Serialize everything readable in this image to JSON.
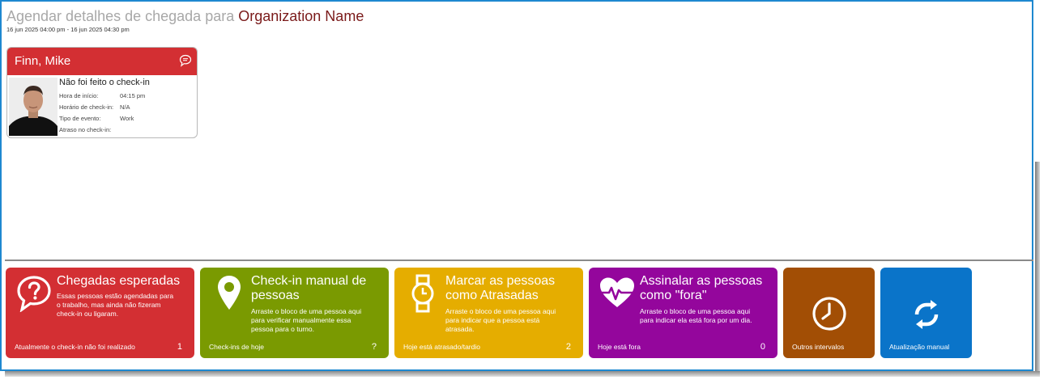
{
  "header": {
    "title_prefix": "Agendar detalhes de chegada para",
    "org_name": "Organization Name",
    "date_range": "16 jun 2025 04:00 pm - 16 jun 2025 04:30 pm"
  },
  "person_card": {
    "name": "Finn, Mike",
    "status": "Não foi feito o check-in",
    "fields": [
      {
        "label": "Hora de início:",
        "value": "04:15 pm"
      },
      {
        "label": "Horário de check-in:",
        "value": "N/A"
      },
      {
        "label": "Tipo de evento:",
        "value": "Work"
      },
      {
        "label": "Atraso no check-in:",
        "value": ""
      }
    ],
    "header_color": "#d32f33",
    "icon": "chat-bubble-icon"
  },
  "tiles": [
    {
      "title_line1": "Chegadas esperadas",
      "title_line2": "",
      "desc": [
        "Essas pessoas estão agendadas para",
        "o trabalho, mas ainda não fizeram",
        "check-in ou ligaram."
      ],
      "footer": "Atualmente o check-in não foi realizado",
      "count": "1",
      "color": "#d32f33",
      "icon": "question-bubble-icon"
    },
    {
      "title_line1": "Check-in manual de",
      "title_line2": "pessoas",
      "desc": [
        "Arraste o bloco de uma pessoa aqui",
        "para verificar manualmente essa",
        "pessoa para o turno."
      ],
      "footer": "Check-ins de hoje",
      "count": "?",
      "color": "#7a9a01",
      "icon": "map-pin-icon"
    },
    {
      "title_line1": "Marcar as pessoas",
      "title_line2": "como Atrasadas",
      "desc": [
        "Arraste o bloco de uma pessoa aqui",
        "para indicar que a pessoa está",
        "atrasada."
      ],
      "footer": "Hoje está atrasado/tardio",
      "count": "2",
      "color": "#e5ad00",
      "icon": "watch-icon"
    },
    {
      "title_line1": "Assinalar as pessoas",
      "title_line2": "como \"fora\"",
      "desc": [
        "Arraste o bloco de uma pessoa aqui",
        "para indicar ela está fora por um dia."
      ],
      "footer": "Hoje está fora",
      "count": "0",
      "color": "#94069c",
      "icon": "heartbeat-icon"
    },
    {
      "title_line1": "",
      "title_line2": "",
      "desc": [],
      "footer": "Outros intervalos",
      "count": "",
      "color": "#a24e05",
      "icon": "clock-icon"
    },
    {
      "title_line1": "",
      "title_line2": "",
      "desc": [],
      "footer": "Atualização manual",
      "count": "",
      "color": "#0a74c9",
      "icon": "refresh-icon"
    }
  ]
}
